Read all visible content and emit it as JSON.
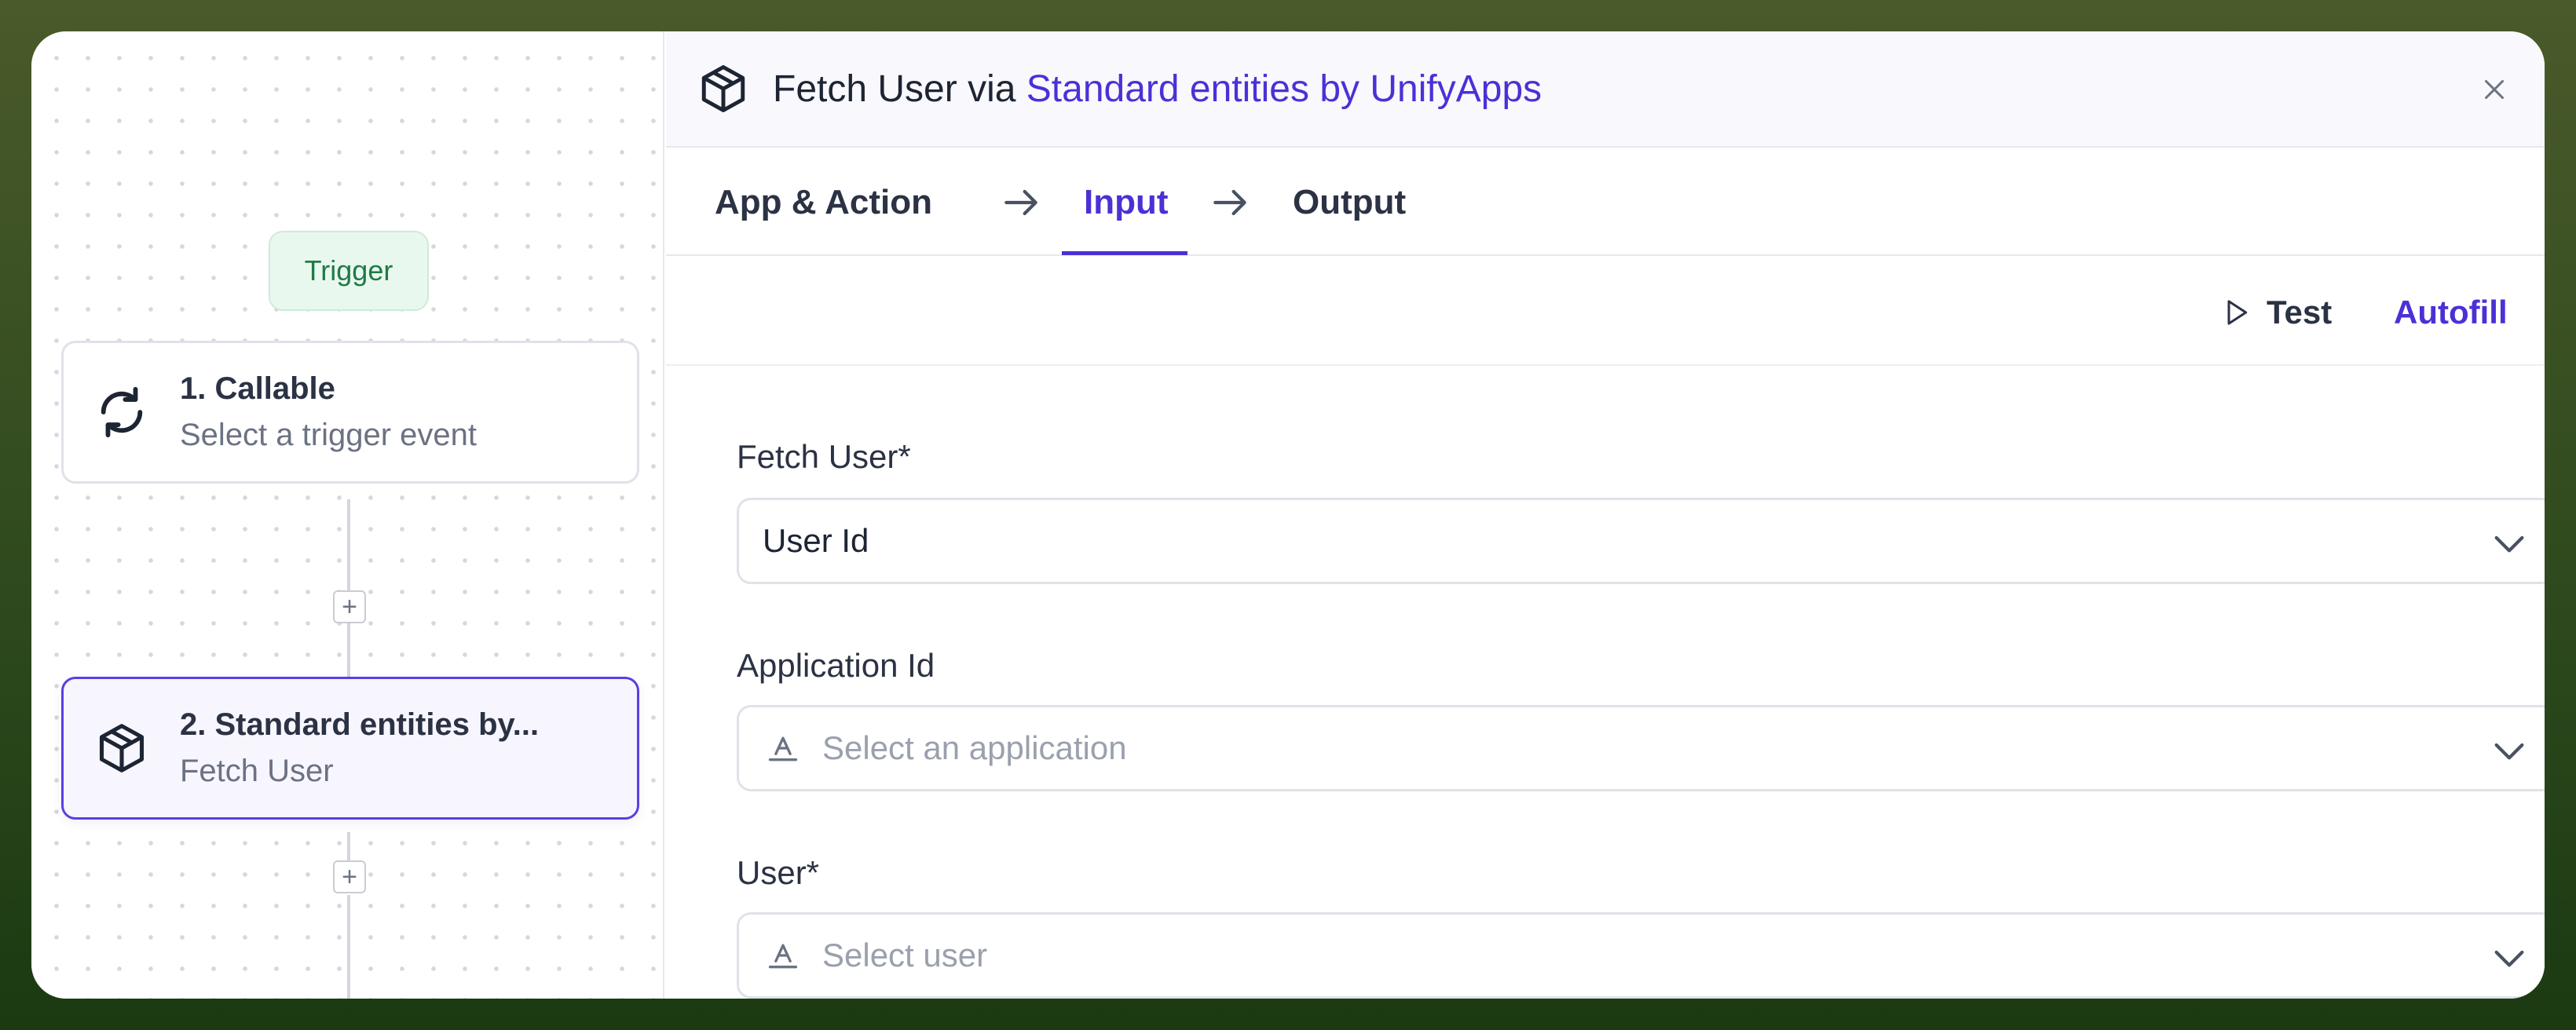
{
  "canvas": {
    "trigger_label": "Trigger",
    "steps": [
      {
        "title": "1. Callable",
        "subtitle": "Select a trigger event",
        "icon": "refresh-icon"
      },
      {
        "title": "2. Standard entities by...",
        "subtitle": "Fetch User",
        "icon": "cube-icon"
      }
    ],
    "add_step_symbol": "+"
  },
  "panel": {
    "header": {
      "title_prefix": "Fetch User via ",
      "title_link": "Standard entities by UnifyApps"
    },
    "tabs": [
      {
        "label": "App & Action",
        "active": false
      },
      {
        "label": "Input",
        "active": true
      },
      {
        "label": "Output",
        "active": false
      }
    ],
    "toolbar": {
      "test_label": "Test",
      "autofill_label": "Autofill"
    },
    "fields": [
      {
        "label": "Fetch User*",
        "value": "User Id",
        "placeholder": ""
      },
      {
        "label": "Application Id",
        "value": "",
        "placeholder": "Select an application"
      },
      {
        "label": "User*",
        "value": "",
        "placeholder": "Select user"
      }
    ]
  },
  "colors": {
    "accent": "#4c30d6",
    "trigger_green": "#1f7a45",
    "frame_bg": "#3b4f23"
  }
}
